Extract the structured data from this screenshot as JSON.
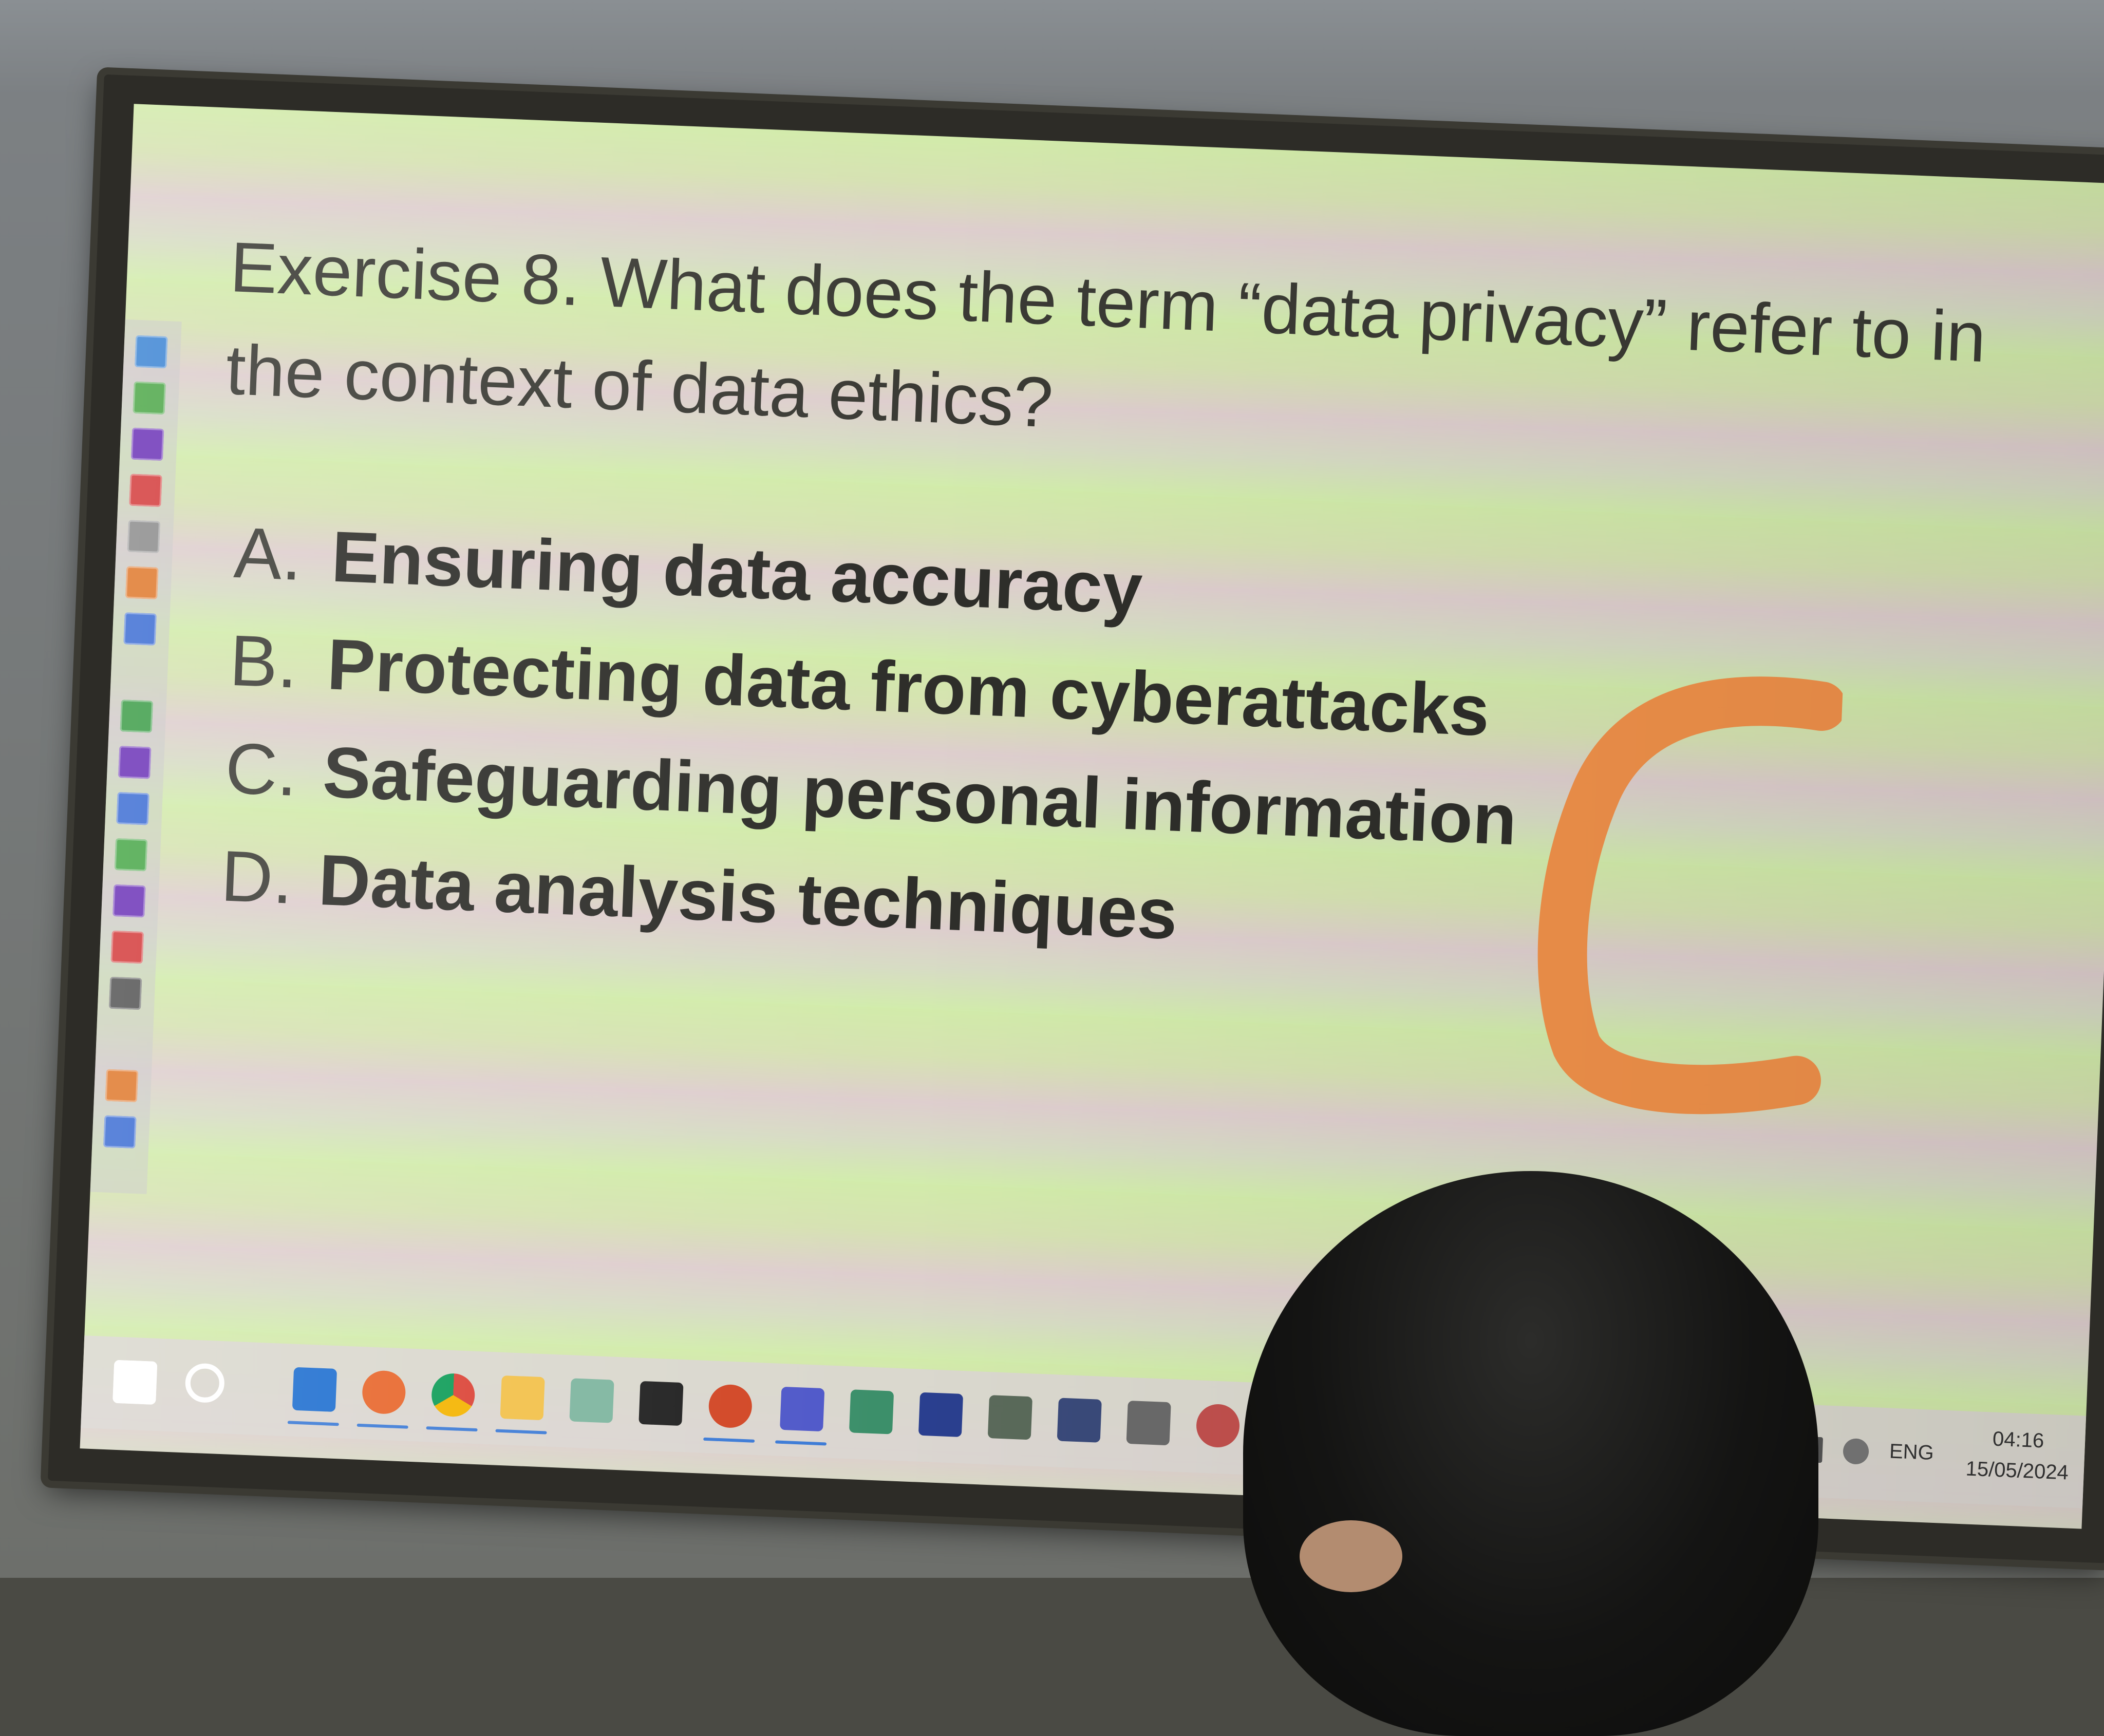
{
  "slide": {
    "question": "Exercise 8. What does the term “data privacy” refer to in the context of data ethics?",
    "options": [
      {
        "letter": "A.",
        "text": "Ensuring data accuracy"
      },
      {
        "letter": "B.",
        "text": "Protecting data from cyberattacks"
      },
      {
        "letter": "C.",
        "text": "Safeguarding personal information"
      },
      {
        "letter": "D.",
        "text": "Data analysis techniques"
      }
    ],
    "handwritten_answer": "C",
    "handwritten_color": "#f0914a"
  },
  "taskbar": {
    "apps": [
      "windows-start-icon",
      "search-icon",
      "outlook-icon",
      "firefox-icon",
      "chrome-icon",
      "file-explorer-icon",
      "notes-icon",
      "terminal-icon",
      "powerpoint-icon",
      "teams-icon",
      "git-icon",
      "mathtype-icon",
      "media-player-icon",
      "chart-app-icon",
      "network-app-icon",
      "recorder-icon"
    ],
    "tray": {
      "language": "ENG",
      "time": "04:16",
      "date": "15/05/2024"
    }
  }
}
